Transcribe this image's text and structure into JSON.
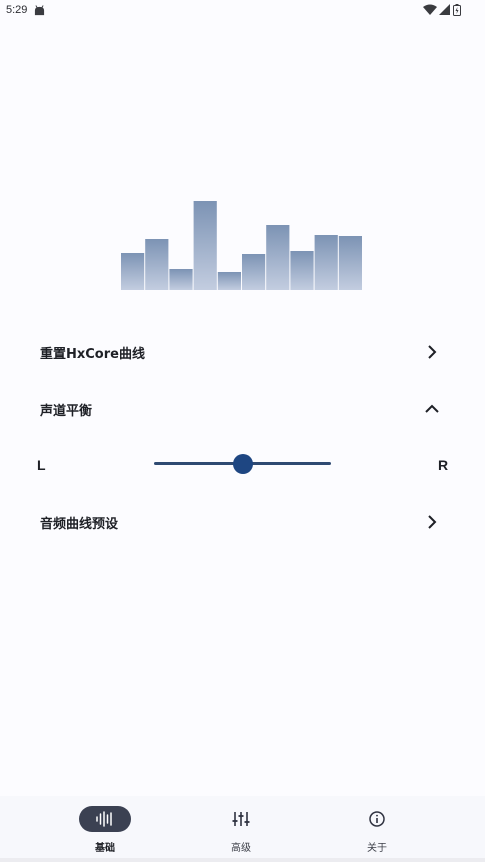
{
  "status_bar": {
    "time": "5:29",
    "app_icon": "android-icon",
    "wifi_icon": "wifi-icon",
    "signal_icon": "cell-signal-icon",
    "battery_icon": "battery-charging-icon"
  },
  "equalizer": {
    "chart_data": {
      "type": "bar",
      "values": [
        37,
        51,
        21,
        89,
        18,
        36,
        65,
        39,
        55,
        54
      ],
      "ylim": [
        0,
        89
      ],
      "colors": {
        "top": "#7c93b4",
        "bottom": "#c3cde0"
      }
    }
  },
  "menu": {
    "reset_curve": {
      "label": "重置HxCore曲线",
      "icon": "chevron-right-icon"
    },
    "channel_balance": {
      "label": "声道平衡",
      "icon": "chevron-up-icon"
    },
    "eq_presets": {
      "label": "音频曲线预设",
      "icon": "chevron-right-icon"
    }
  },
  "balance": {
    "left_label": "L",
    "right_label": "R",
    "value": 0.5
  },
  "nav": {
    "items": [
      {
        "label": "基础",
        "icon": "waveform-icon",
        "active": true
      },
      {
        "label": "高级",
        "icon": "sliders-icon",
        "active": false
      },
      {
        "label": "关于",
        "icon": "info-icon",
        "active": false
      }
    ]
  },
  "colors": {
    "accent": "#1e4682",
    "track": "#2f4a72",
    "active_pill": "#3b4152",
    "background": "#fcfcff"
  }
}
